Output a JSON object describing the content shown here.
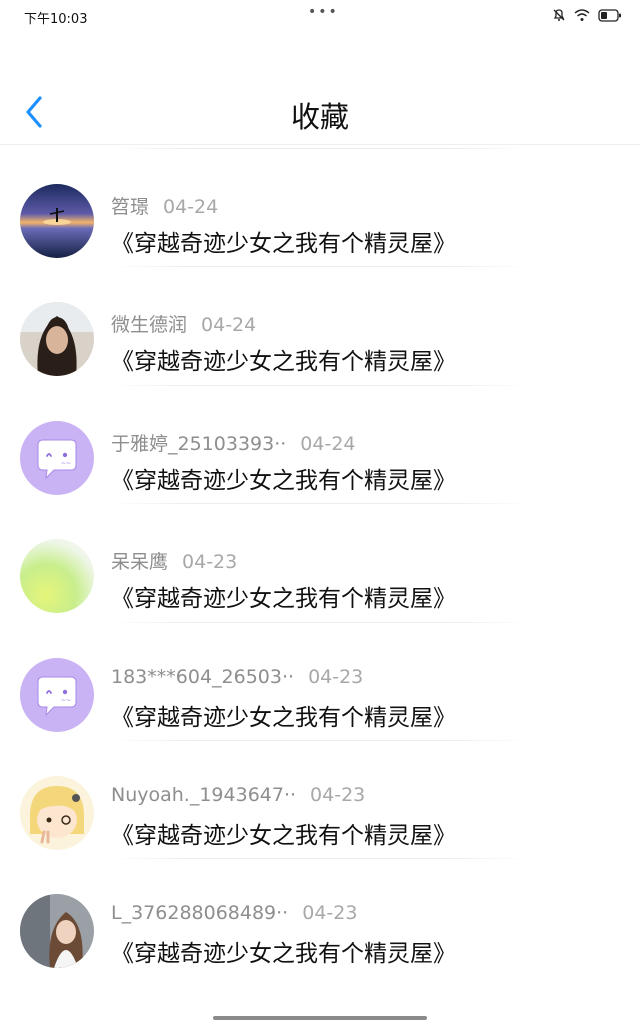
{
  "status_bar": {
    "time": "下午10:03",
    "dots": "•••"
  },
  "header": {
    "title": "收藏"
  },
  "favorites": [
    {
      "name": "笤璟",
      "date": "04-24",
      "book": "《穿越奇迹少女之我有个精灵屋》",
      "avatar": "sunset-reflection-photo"
    },
    {
      "name": "微生德润",
      "date": "04-24",
      "book": "《穿越奇迹少女之我有个精灵屋》",
      "avatar": "woman-portrait-photo"
    },
    {
      "name": "于雅婷_25103393··",
      "date": "04-24",
      "book": "《穿越奇迹少女之我有个精灵屋》",
      "avatar": "default-chat-bubble"
    },
    {
      "name": "呆呆鹰",
      "date": "04-23",
      "book": "《穿越奇迹少女之我有个精灵屋》",
      "avatar": "gradient-green-yellow"
    },
    {
      "name": "183***604_26503··",
      "date": "04-23",
      "book": "《穿越奇迹少女之我有个精灵屋》",
      "avatar": "default-chat-bubble"
    },
    {
      "name": "Nuyoah._1943647··",
      "date": "04-23",
      "book": "《穿越奇迹少女之我有个精灵屋》",
      "avatar": "cartoon-girl"
    },
    {
      "name": "L_376288068489··",
      "date": "04-23",
      "book": "《穿越奇迹少女之我有个精灵屋》",
      "avatar": "girl-photo"
    }
  ],
  "colors": {
    "accent": "#1e90ff",
    "default_avatar_bg": "#c9b3f5",
    "name_gray": "#8e8e8e"
  }
}
